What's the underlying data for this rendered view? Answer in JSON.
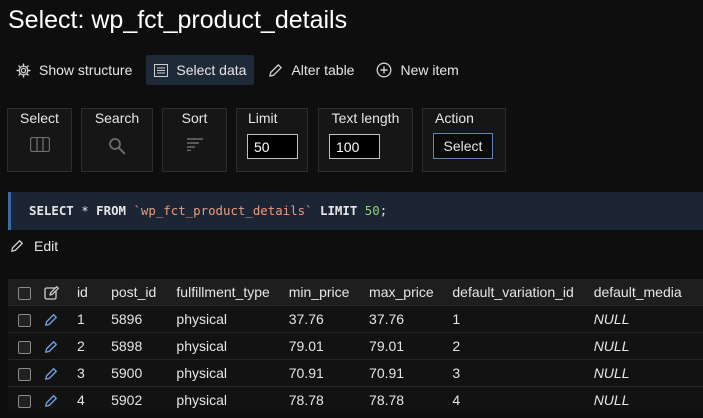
{
  "title": "Select: wp_fct_product_details",
  "toolbar": {
    "show_structure": "Show structure",
    "select_data": "Select data",
    "alter_table": "Alter table",
    "new_item": "New item"
  },
  "controls": {
    "select_label": "Select",
    "search_label": "Search",
    "sort_label": "Sort",
    "limit_label": "Limit",
    "limit_value": "50",
    "text_length_label": "Text length",
    "text_length_value": "100",
    "action_label": "Action",
    "action_button": "Select"
  },
  "sql": {
    "select": "SELECT",
    "star": " * ",
    "from": "FROM",
    "table": "`wp_fct_product_details`",
    "limit": "LIMIT",
    "limit_num": "50",
    "semicolon": ";"
  },
  "edit_label": "Edit",
  "table": {
    "columns": [
      "id",
      "post_id",
      "fulfillment_type",
      "min_price",
      "max_price",
      "default_variation_id",
      "default_media"
    ],
    "rows": [
      [
        "1",
        "5896",
        "physical",
        "37.76",
        "37.76",
        "1",
        "NULL"
      ],
      [
        "2",
        "5898",
        "physical",
        "79.01",
        "79.01",
        "2",
        "NULL"
      ],
      [
        "3",
        "5900",
        "physical",
        "70.91",
        "70.91",
        "3",
        "NULL"
      ],
      [
        "4",
        "5902",
        "physical",
        "78.78",
        "78.78",
        "4",
        "NULL"
      ]
    ]
  },
  "colors": {
    "background": "#0e0e0e",
    "active_tab": "#1f2a38",
    "sql_bg": "#1c2533",
    "sql_string": "#e89b7c",
    "sql_number": "#8fcf7a",
    "button_border": "#5a86b8"
  }
}
